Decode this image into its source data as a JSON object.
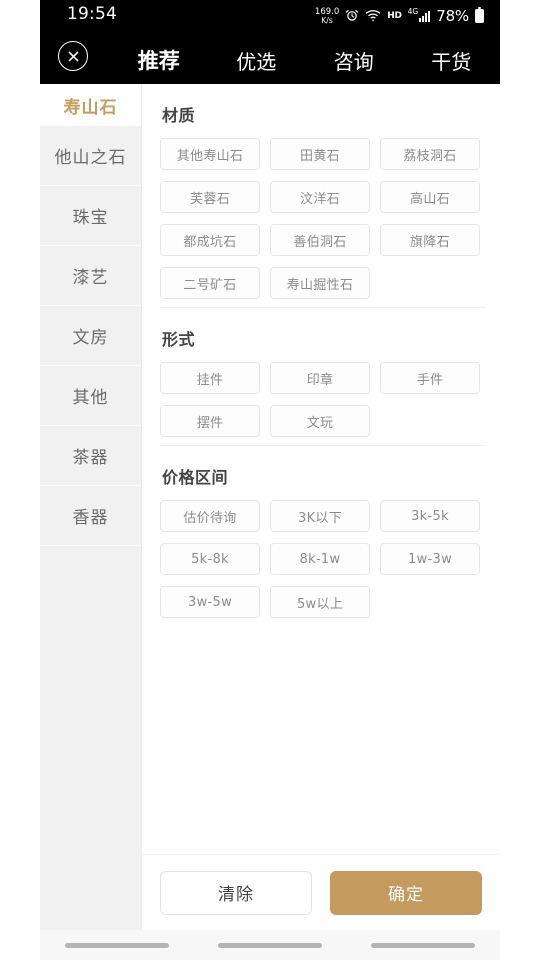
{
  "status_bar": {
    "time": "19:54",
    "net_speed_value": "169.0",
    "net_speed_unit": "K/s",
    "hd_label": "HD",
    "network_label": "4G",
    "battery_percent": "78%"
  },
  "header": {
    "close_label": "×",
    "tabs": [
      {
        "label": "推荐",
        "active": true
      },
      {
        "label": "优选",
        "active": false
      },
      {
        "label": "咨询",
        "active": false
      },
      {
        "label": "干货",
        "active": false
      }
    ]
  },
  "sidebar": {
    "selected": "寿山石",
    "items": [
      {
        "label": "他山之石"
      },
      {
        "label": "珠宝"
      },
      {
        "label": "漆艺"
      },
      {
        "label": "文房"
      },
      {
        "label": "其他"
      },
      {
        "label": "茶器"
      },
      {
        "label": "香器"
      }
    ]
  },
  "filters": {
    "sections": [
      {
        "title": "材质",
        "options": [
          "其他寿山石",
          "田黄石",
          "荔枝洞石",
          "芙蓉石",
          "汶洋石",
          "高山石",
          "都成坑石",
          "善伯洞石",
          "旗降石",
          "二号矿石",
          "寿山掘性石"
        ]
      },
      {
        "title": "形式",
        "options": [
          "挂件",
          "印章",
          "手件",
          "摆件",
          "文玩"
        ]
      },
      {
        "title": "价格区间",
        "options": [
          "估价待询",
          "3K以下",
          "3k-5k",
          "5k-8k",
          "8k-1w",
          "1w-3w",
          "3w-5w",
          "5w以上"
        ]
      }
    ]
  },
  "footer": {
    "clear_label": "清除",
    "confirm_label": "确定"
  },
  "colors": {
    "accent_gold": "#c49a5e",
    "sidebar_selected_text": "#c49c5e",
    "chip_border": "#e6e6e6",
    "chip_text": "#8c8c8c"
  }
}
